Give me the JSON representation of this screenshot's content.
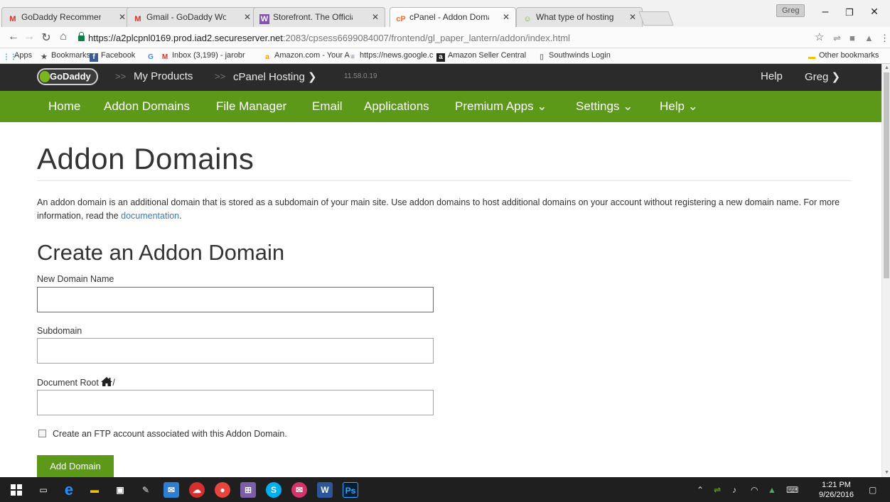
{
  "browser": {
    "tabs": [
      {
        "title": "GoDaddy Recommends a",
        "favicon": "gmail-icon"
      },
      {
        "title": "Gmail - GoDaddy WordP",
        "favicon": "gmail-icon"
      },
      {
        "title": "Storefront. The Official W",
        "favicon": "woo-icon"
      },
      {
        "title": "cPanel - Addon Domains",
        "favicon": "cpanel-icon"
      },
      {
        "title": "What type of hosting acc",
        "favicon": "godaddy-icon"
      }
    ],
    "profile_label": "Greg",
    "url_host": "https://a2plcpnl0169.prod.iad2.secureserver.net",
    "url_path": ":2083/cpsess6699084007/frontend/gl_paper_lantern/addon/index.html",
    "bookmarks": [
      "Apps",
      "Bookmarks",
      "Facebook",
      "Inbox (3,199) - jarobr",
      "Amazon.com - Your A",
      "https://news.google.c",
      "Amazon Seller Central",
      "Southwinds Login"
    ],
    "other_bookmarks": "Other bookmarks"
  },
  "cpanel": {
    "logo_text": "GoDaddy",
    "breadcrumb_products": "My Products",
    "breadcrumb_hosting": "cPanel Hosting ❯",
    "version": "11.58.0.19",
    "help": "Help",
    "user": "Greg ❯",
    "nav": [
      "Home",
      "Addon Domains",
      "File Manager",
      "Email",
      "Applications",
      "Premium Apps ⌄",
      "Settings ⌄",
      "Help ⌄"
    ]
  },
  "page": {
    "title": "Addon Domains",
    "intro_text": "An addon domain is an additional domain that is stored as a subdomain of your main site. Use addon domains to host additional domains on your account without registering a new domain name. For more information, read the ",
    "intro_link": "documentation",
    "intro_end": ".",
    "section_title": "Create an Addon Domain",
    "label_new_domain": "New Domain Name",
    "label_subdomain": "Subdomain",
    "label_docroot": "Document Root",
    "docroot_suffix": "/",
    "value_new_domain": "",
    "value_subdomain": "",
    "value_docroot": "",
    "ftp_checkbox_label": "Create an FTP account associated with this Addon Domain.",
    "ftp_checked": false,
    "add_button": "Add Domain"
  },
  "taskbar": {
    "time": "1:21 PM",
    "date": "9/26/2016"
  },
  "colors": {
    "nav_green": "#5c9919",
    "topbar": "#2b2b2b",
    "link": "#3b7bbf"
  }
}
